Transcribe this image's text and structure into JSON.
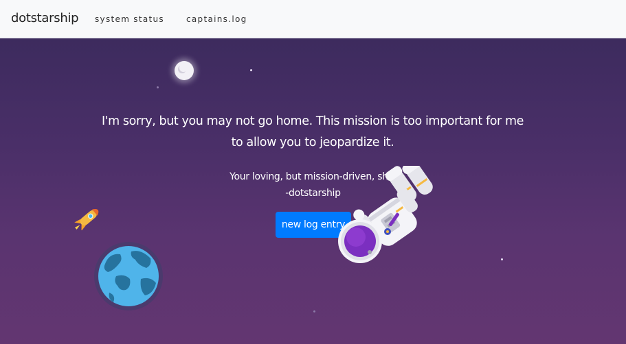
{
  "navbar": {
    "brand": "dotstarship",
    "links": [
      {
        "label": "system status"
      },
      {
        "label": "captains.log"
      }
    ]
  },
  "main": {
    "message": "I'm sorry, but you may not go home. This mission is too important for me to allow you to jeopardize it.",
    "signoff_line1": "Your loving, but mission-driven, ship",
    "signoff_line2": "-dotstarship",
    "button_label": "new log entry"
  },
  "colors": {
    "navbar_bg": "#f8f9fa",
    "space_top": "#3d2b5e",
    "space_bottom": "#633671",
    "button": "#007bff",
    "earth_ocean": "#4fb4ea",
    "earth_land": "#26739e"
  },
  "icons": [
    "moon-icon",
    "rocket-icon",
    "earth-icon",
    "astronaut-icon"
  ]
}
